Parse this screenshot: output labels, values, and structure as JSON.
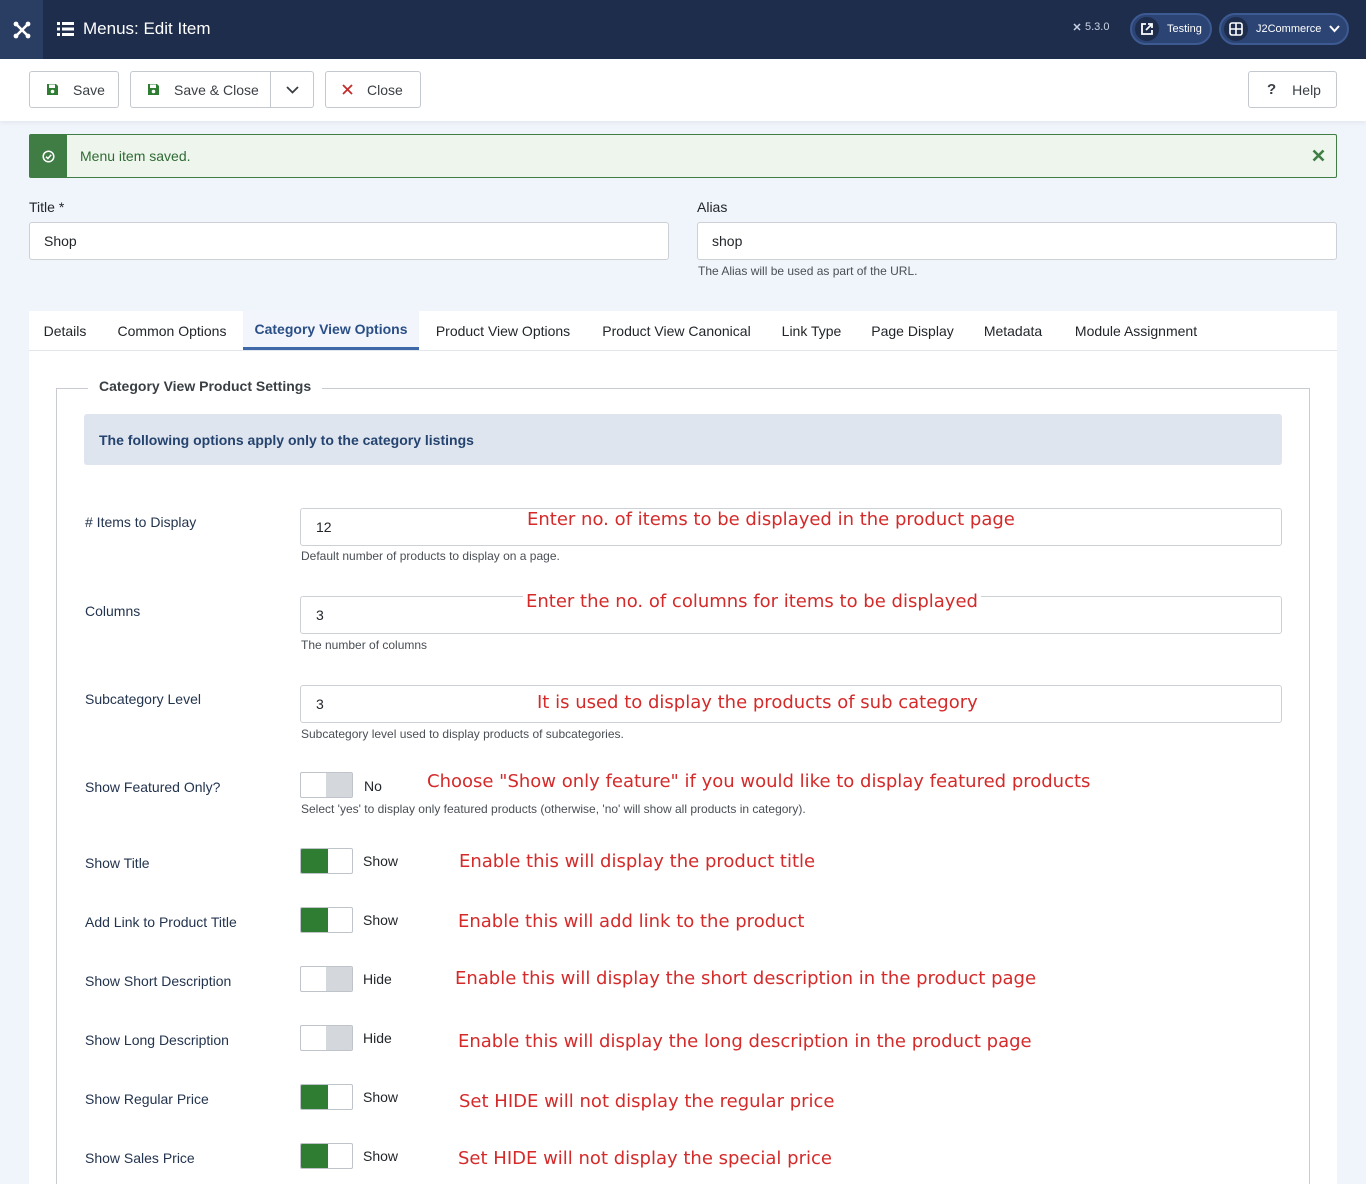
{
  "header": {
    "title": "Menus: Edit Item",
    "version": "5.3.0",
    "site_button": "Testing",
    "user_button": "J2Commerce"
  },
  "toolbar": {
    "save_label": "Save",
    "save_close_label": "Save & Close",
    "close_label": "Close",
    "help_label": "Help"
  },
  "alert": {
    "message": "Menu item saved."
  },
  "form": {
    "title_label": "Title *",
    "title_value": "Shop",
    "alias_label": "Alias",
    "alias_value": "shop",
    "alias_hint": "The Alias will be used as part of the URL."
  },
  "tabs": [
    {
      "label": "Details"
    },
    {
      "label": "Common Options"
    },
    {
      "label": "Category View Options"
    },
    {
      "label": "Product View Options"
    },
    {
      "label": "Product View Canonical"
    },
    {
      "label": "Link Type"
    },
    {
      "label": "Page Display"
    },
    {
      "label": "Metadata"
    },
    {
      "label": "Module Assignment"
    }
  ],
  "fieldset": {
    "legend": "Category View Product Settings",
    "info": "The following options apply only to the category listings"
  },
  "fields": {
    "items": {
      "label": "# Items to Display",
      "value": "12",
      "hint": "Default number of products to display on a page.",
      "annotation": "Enter no. of items to be displayed in the product page"
    },
    "columns": {
      "label": "Columns",
      "value": "3",
      "hint": "The number of columns",
      "annotation": "Enter the no. of columns for items to be displayed"
    },
    "subcategory": {
      "label": "Subcategory Level",
      "value": "3",
      "hint": "Subcategory level used to display products of subcategories.",
      "annotation": "It is used to display the products of sub category"
    },
    "featured": {
      "label": "Show Featured Only?",
      "state": "No",
      "hint": "Select 'yes' to display only featured products (otherwise, 'no' will show all products in category).",
      "annotation": "Choose \"Show only feature\" if you would like to display featured products"
    },
    "show_title": {
      "label": "Show Title",
      "state": "Show",
      "annotation": "Enable this will display the product title"
    },
    "link_title": {
      "label": "Add Link to Product Title",
      "state": "Show",
      "annotation": "Enable this will add link to the product"
    },
    "short_desc": {
      "label": "Show Short Description",
      "state": "Hide",
      "annotation": "Enable this will display the short description in the product page"
    },
    "long_desc": {
      "label": "Show Long Description",
      "state": "Hide",
      "annotation": "Enable this will display the long description in the product page"
    },
    "regular_price": {
      "label": "Show Regular Price",
      "state": "Show",
      "annotation": "Set HIDE will not display the regular price"
    },
    "sales_price": {
      "label": "Show Sales Price",
      "state": "Show",
      "annotation": "Set HIDE will not display the special price"
    }
  },
  "colors": {
    "header_bg": "#1d2d4b",
    "switch_on": "#2f7d32",
    "alert_green": "#3f7d45",
    "annotation_red": "#d42a2a",
    "active_tab": "#2a4f86"
  }
}
